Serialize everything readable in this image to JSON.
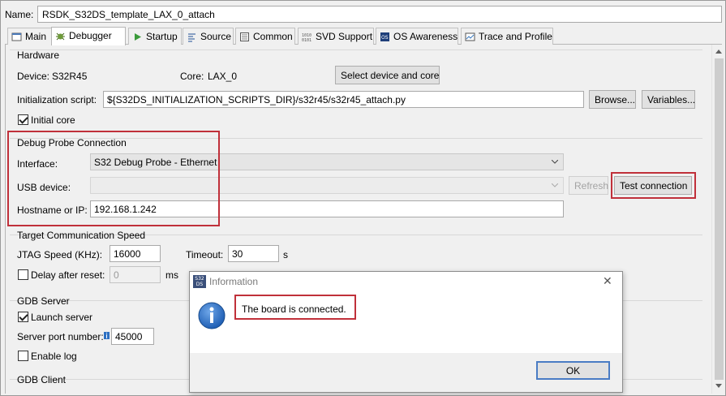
{
  "name_row": {
    "label": "Name:",
    "value": "RSDK_S32DS_template_LAX_0_attach"
  },
  "tabs": [
    {
      "label": "Main",
      "icon": "main-icon"
    },
    {
      "label": "Debugger",
      "icon": "debugger-icon",
      "active": true
    },
    {
      "label": "Startup",
      "icon": "startup-icon"
    },
    {
      "label": "Source",
      "icon": "source-icon"
    },
    {
      "label": "Common",
      "icon": "common-icon"
    },
    {
      "label": "SVD Support",
      "icon": "svd-icon"
    },
    {
      "label": "OS Awareness",
      "icon": "os-icon"
    },
    {
      "label": "Trace and Profile",
      "icon": "trace-icon"
    }
  ],
  "hardware": {
    "title": "Hardware",
    "device_label": "Device:",
    "device_value": "S32R45",
    "core_label": "Core:",
    "core_value": "LAX_0",
    "select_button": "Select device and core",
    "init_script_label": "Initialization script:",
    "init_script_value": "${S32DS_INITIALIZATION_SCRIPTS_DIR}/s32r45/s32r45_attach.py",
    "browse_button": "Browse...",
    "variables_button": "Variables...",
    "initial_core_label": "Initial core",
    "initial_core_checked": true
  },
  "probe": {
    "title": "Debug Probe Connection",
    "interface_label": "Interface:",
    "interface_value": "S32 Debug Probe - Ethernet",
    "usb_label": "USB device:",
    "usb_value": "",
    "refresh_button": "Refresh",
    "test_button": "Test connection",
    "hostname_label": "Hostname or IP:",
    "hostname_value": "192.168.1.242"
  },
  "speed": {
    "title": "Target Communication Speed",
    "jtag_label": "JTAG Speed (KHz):",
    "jtag_value": "16000",
    "timeout_label": "Timeout:",
    "timeout_value": "30",
    "timeout_unit": "s",
    "delay_label": "Delay after reset:",
    "delay_value": "0",
    "delay_unit": "ms",
    "delay_checked": false
  },
  "gdb_server": {
    "title": "GDB Server",
    "launch_label": "Launch server",
    "launch_checked": true,
    "port_label": "Server port number:",
    "port_value": "45000",
    "log_label": "Enable log",
    "log_checked": false
  },
  "gdb_client": {
    "title": "GDB Client"
  },
  "dialog": {
    "app_icon_text": "S32 DS",
    "title": "Information",
    "message": "The board is connected.",
    "ok_button": "OK",
    "close_glyph": "✕"
  },
  "colors": {
    "highlight_box": "#c0303a",
    "info_icon": "#1f5fb4"
  }
}
